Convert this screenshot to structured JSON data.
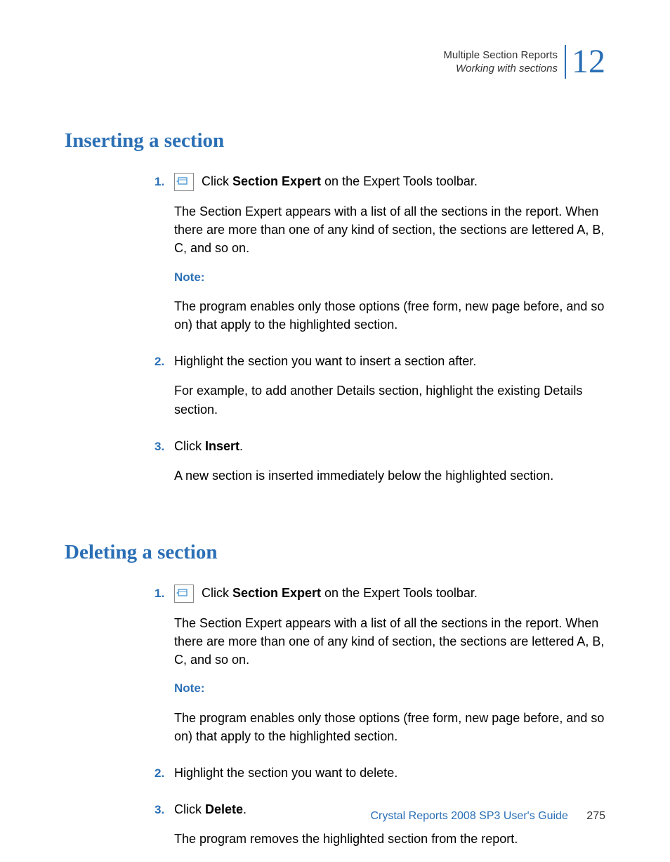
{
  "header": {
    "breadcrumb_top": "Multiple Section Reports",
    "breadcrumb_bottom": "Working with sections",
    "chapter_number": "12"
  },
  "section1": {
    "title": "Inserting a section",
    "step1": {
      "num": "1.",
      "text_before": " Click ",
      "bold": "Section Expert",
      "text_after": " on the Expert Tools toolbar.",
      "para2": "The Section Expert appears with a list of all the sections in the report. When there are more than one of any kind of section, the sections are lettered A, B, C, and so on.",
      "note_label": "Note:",
      "note_text": "The program enables only those options (free form, new page before, and so on) that apply to the highlighted section."
    },
    "step2": {
      "num": "2.",
      "text": "Highlight the section you want to insert a section after.",
      "para2": "For example, to add another Details section, highlight the existing Details section."
    },
    "step3": {
      "num": "3.",
      "text_before": "Click ",
      "bold": "Insert",
      "text_after": ".",
      "para2": "A new section is inserted immediately below the highlighted section."
    }
  },
  "section2": {
    "title": "Deleting a section",
    "step1": {
      "num": "1.",
      "text_before": " Click ",
      "bold": "Section Expert",
      "text_after": " on the Expert Tools toolbar.",
      "para2": "The Section Expert appears with a list of all the sections in the report. When there are more than one of any kind of section, the sections are lettered A, B, C, and so on.",
      "note_label": "Note:",
      "note_text": "The program enables only those options (free form, new page before, and so on) that apply to the highlighted section."
    },
    "step2": {
      "num": "2.",
      "text": "Highlight the section you want to delete."
    },
    "step3": {
      "num": "3.",
      "text_before": "Click ",
      "bold": "Delete",
      "text_after": ".",
      "para2": "The program removes the highlighted section from the report."
    }
  },
  "footer": {
    "guide": "Crystal Reports 2008 SP3 User's Guide",
    "page": "275"
  }
}
